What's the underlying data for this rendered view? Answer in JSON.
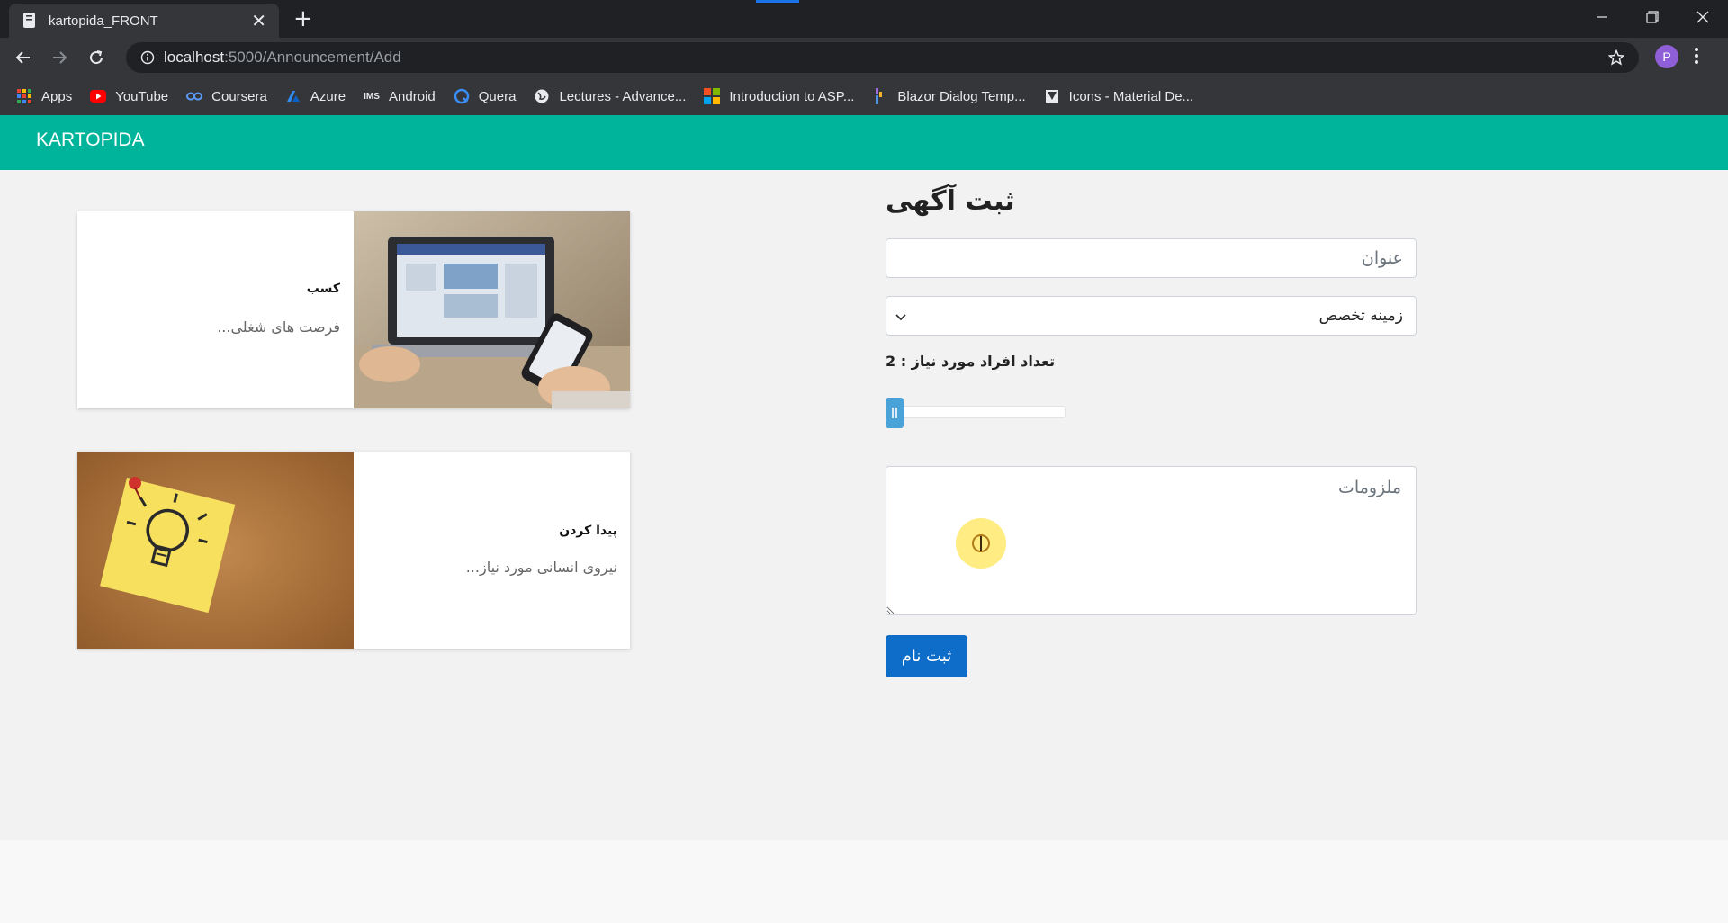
{
  "browser": {
    "tab_title": "kartopida_FRONT",
    "url_host": "localhost",
    "url_path": ":5000/Announcement/Add",
    "profile_initial": "P",
    "bookmarks": [
      {
        "label": "Apps",
        "icon": "apps-grid-icon"
      },
      {
        "label": "YouTube",
        "icon": "youtube-icon"
      },
      {
        "label": "Coursera",
        "icon": "coursera-icon"
      },
      {
        "label": "Azure",
        "icon": "azure-icon"
      },
      {
        "label": "Android",
        "icon": "android-icon"
      },
      {
        "label": "Quera",
        "icon": "quera-icon"
      },
      {
        "label": "Lectures - Advance...",
        "icon": "globe-icon"
      },
      {
        "label": "Introduction to ASP...",
        "icon": "microsoft-icon"
      },
      {
        "label": "Blazor Dialog Temp...",
        "icon": "blazor-icon"
      },
      {
        "label": "Icons - Material De...",
        "icon": "material-icon"
      }
    ]
  },
  "app": {
    "brand": "KARTOPIDA"
  },
  "cards": [
    {
      "title": "کسب",
      "description": "فرصت های شغلی..."
    },
    {
      "title": "پیدا کردن",
      "description": "نیروی انسانی مورد نیاز..."
    }
  ],
  "form": {
    "heading": "ثبت آگهی",
    "title_placeholder": "عنوان",
    "specialty_selected": "زمینه تخصص",
    "count_label": "تعداد افراد مورد نیاز : 2",
    "count_value": 2,
    "requirements_placeholder": "ملزومات",
    "submit_label": "ثبت نام"
  },
  "colors": {
    "navbar": "#00b39b",
    "primary_button": "#0d6dc9",
    "slider_thumb": "#4aa3d8"
  }
}
